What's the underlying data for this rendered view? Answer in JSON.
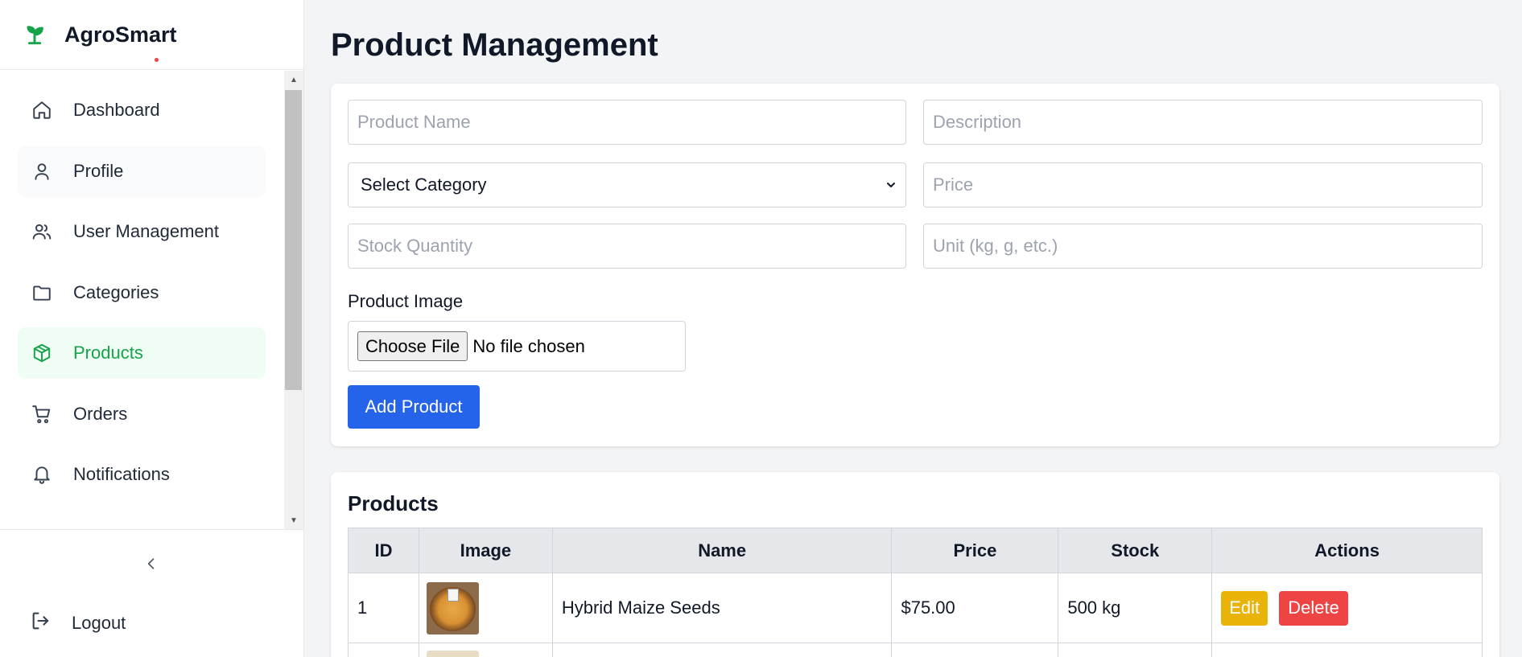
{
  "app": {
    "name": "AgroSmart"
  },
  "sidebar": {
    "items": [
      {
        "label": "Dashboard",
        "icon": "home-icon"
      },
      {
        "label": "Profile",
        "icon": "user-icon"
      },
      {
        "label": "User Management",
        "icon": "users-icon"
      },
      {
        "label": "Categories",
        "icon": "folder-icon"
      },
      {
        "label": "Products",
        "icon": "box-icon",
        "active": true
      },
      {
        "label": "Orders",
        "icon": "cart-icon"
      },
      {
        "label": "Notifications",
        "icon": "bell-icon"
      }
    ],
    "logout_label": "Logout"
  },
  "page": {
    "title": "Product Management"
  },
  "form": {
    "product_name_placeholder": "Product Name",
    "description_placeholder": "Description",
    "category_selected": "Select Category",
    "price_placeholder": "Price",
    "stock_placeholder": "Stock Quantity",
    "unit_placeholder": "Unit (kg, g, etc.)",
    "image_label": "Product Image",
    "file_button": "Choose File",
    "file_status": "No file chosen",
    "submit_label": "Add Product"
  },
  "products": {
    "title": "Products",
    "columns": [
      "ID",
      "Image",
      "Name",
      "Price",
      "Stock",
      "Actions"
    ],
    "rows": [
      {
        "id": "1",
        "name": "Hybrid Maize Seeds",
        "price": "$75.00",
        "stock": "500 kg",
        "edit": "Edit",
        "delete": "Delete"
      }
    ]
  },
  "colors": {
    "brand_green": "#16a34a",
    "primary_blue": "#2563eb",
    "edit_yellow": "#eab308",
    "delete_red": "#ef4444"
  }
}
